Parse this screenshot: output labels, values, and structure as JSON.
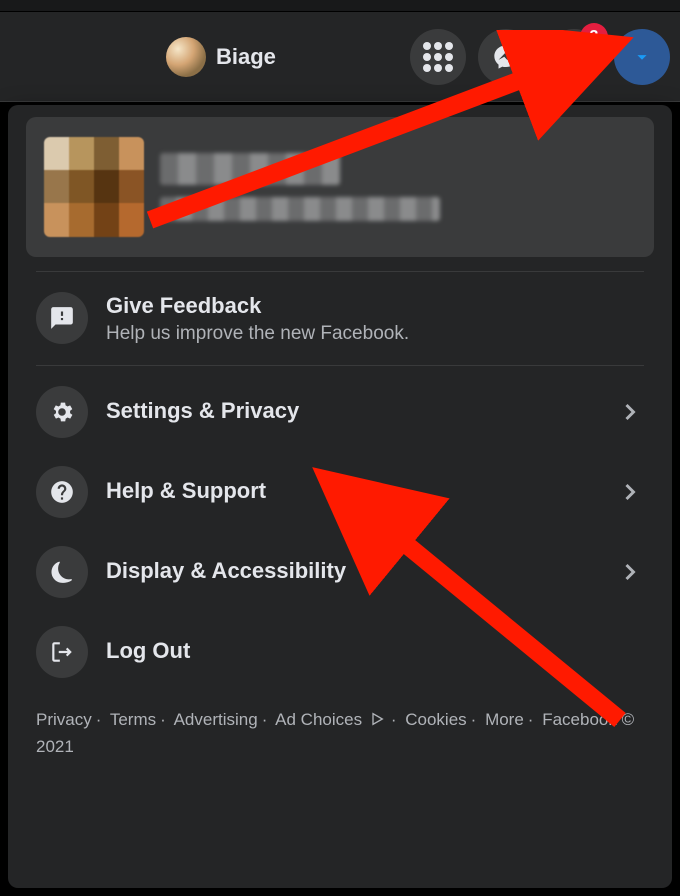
{
  "header": {
    "profile_name": "Biage",
    "notifications_badge": "3"
  },
  "menu": {
    "feedback": {
      "title": "Give Feedback",
      "subtitle": "Help us improve the new Facebook."
    },
    "settings": {
      "label": "Settings & Privacy"
    },
    "help": {
      "label": "Help & Support"
    },
    "display": {
      "label": "Display & Accessibility"
    },
    "logout": {
      "label": "Log Out"
    }
  },
  "footer": {
    "privacy": "Privacy",
    "terms": "Terms",
    "advertising": "Advertising",
    "ad_choices": "Ad Choices",
    "cookies": "Cookies",
    "more": "More",
    "copyright": "Facebook © 2021"
  }
}
